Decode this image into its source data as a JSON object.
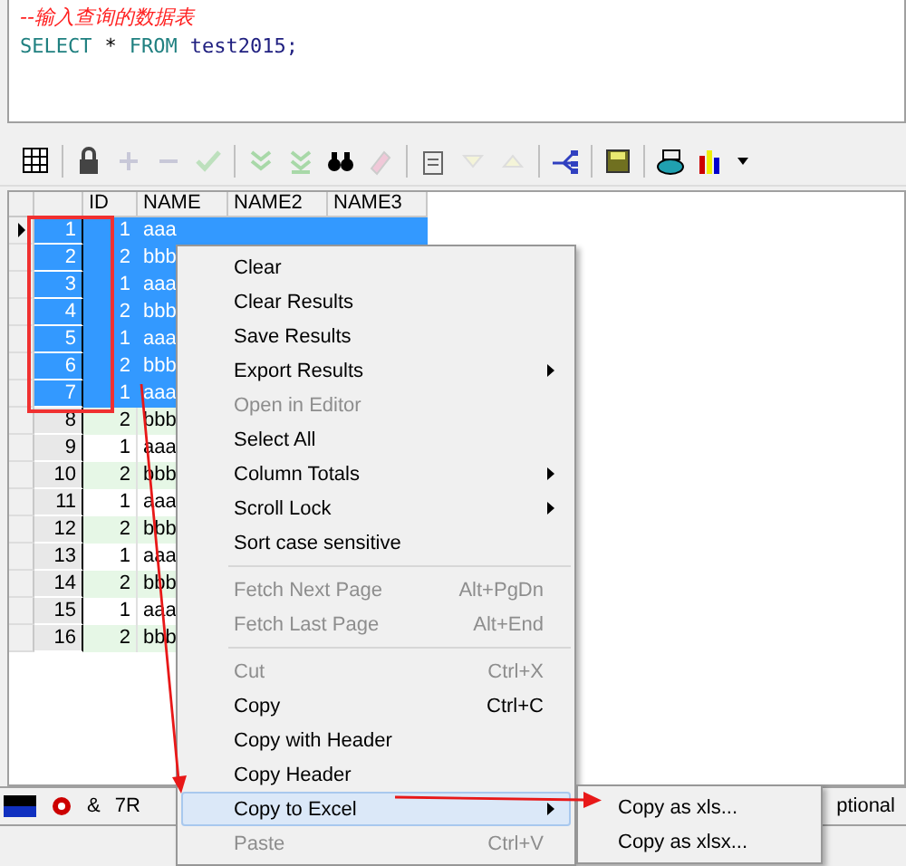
{
  "editor": {
    "comment": "--输入查询的数据表",
    "tokens": [
      {
        "text": "SELECT",
        "kind": "keyword"
      },
      {
        "text": "*",
        "kind": "operator"
      },
      {
        "text": "FROM",
        "kind": "keyword"
      },
      {
        "text": "test2015;",
        "kind": "identifier"
      }
    ]
  },
  "grid": {
    "columns": [
      "ID",
      "NAME",
      "NAME2",
      "NAME3"
    ],
    "rows": [
      {
        "num": "1",
        "id": "1",
        "name": "aaa",
        "selected": true,
        "current": true
      },
      {
        "num": "2",
        "id": "2",
        "name": "bbb",
        "selected": true,
        "current": false
      },
      {
        "num": "3",
        "id": "1",
        "name": "aaa",
        "selected": true,
        "current": false
      },
      {
        "num": "4",
        "id": "2",
        "name": "bbb",
        "selected": true,
        "current": false
      },
      {
        "num": "5",
        "id": "1",
        "name": "aaa",
        "selected": true,
        "current": false
      },
      {
        "num": "6",
        "id": "2",
        "name": "bbb",
        "selected": true,
        "current": false
      },
      {
        "num": "7",
        "id": "1",
        "name": "aaa",
        "selected": true,
        "current": false
      },
      {
        "num": "8",
        "id": "2",
        "name": "bbb",
        "selected": false,
        "current": false
      },
      {
        "num": "9",
        "id": "1",
        "name": "aaa",
        "selected": false,
        "current": false
      },
      {
        "num": "10",
        "id": "2",
        "name": "bbb",
        "selected": false,
        "current": false
      },
      {
        "num": "11",
        "id": "1",
        "name": "aaa",
        "selected": false,
        "current": false
      },
      {
        "num": "12",
        "id": "2",
        "name": "bbb",
        "selected": false,
        "current": false
      },
      {
        "num": "13",
        "id": "1",
        "name": "aaa",
        "selected": false,
        "current": false
      },
      {
        "num": "14",
        "id": "2",
        "name": "bbb",
        "selected": false,
        "current": false
      },
      {
        "num": "15",
        "id": "1",
        "name": "aaa",
        "selected": false,
        "current": false
      },
      {
        "num": "16",
        "id": "2",
        "name": "bbb",
        "selected": false,
        "current": false
      }
    ]
  },
  "context_menu": {
    "items": [
      {
        "kind": "item",
        "label": "Clear",
        "disabled": false,
        "submenu": false,
        "selected": false
      },
      {
        "kind": "item",
        "label": "Clear Results",
        "disabled": false,
        "submenu": false,
        "selected": false
      },
      {
        "kind": "item",
        "label": "Save Results",
        "disabled": false,
        "submenu": false,
        "selected": false
      },
      {
        "kind": "item",
        "label": "Export Results",
        "disabled": false,
        "submenu": true,
        "selected": false
      },
      {
        "kind": "item",
        "label": "Open in Editor",
        "disabled": true,
        "submenu": false,
        "selected": false
      },
      {
        "kind": "item",
        "label": "Select All",
        "disabled": false,
        "submenu": false,
        "selected": false
      },
      {
        "kind": "item",
        "label": "Column Totals",
        "disabled": false,
        "submenu": true,
        "selected": false
      },
      {
        "kind": "item",
        "label": "Scroll Lock",
        "disabled": false,
        "submenu": true,
        "selected": false
      },
      {
        "kind": "item",
        "label": "Sort case sensitive",
        "disabled": false,
        "submenu": false,
        "selected": false
      },
      {
        "kind": "separator"
      },
      {
        "kind": "item",
        "label": "Fetch Next Page",
        "shortcut": "Alt+PgDn",
        "disabled": true,
        "submenu": false,
        "selected": false
      },
      {
        "kind": "item",
        "label": "Fetch Last Page",
        "shortcut": "Alt+End",
        "disabled": true,
        "submenu": false,
        "selected": false
      },
      {
        "kind": "separator"
      },
      {
        "kind": "item",
        "label": "Cut",
        "shortcut": "Ctrl+X",
        "disabled": true,
        "submenu": false,
        "selected": false
      },
      {
        "kind": "item",
        "label": "Copy",
        "shortcut": "Ctrl+C",
        "disabled": false,
        "submenu": false,
        "selected": false
      },
      {
        "kind": "item",
        "label": "Copy with Header",
        "disabled": false,
        "submenu": false,
        "selected": false
      },
      {
        "kind": "item",
        "label": "Copy Header",
        "disabled": false,
        "submenu": false,
        "selected": false
      },
      {
        "kind": "item",
        "label": "Copy to Excel",
        "disabled": false,
        "submenu": true,
        "selected": true
      },
      {
        "kind": "item",
        "label": "Paste",
        "shortcut": "Ctrl+V",
        "disabled": true,
        "submenu": false,
        "selected": false
      }
    ]
  },
  "submenu": {
    "items": [
      {
        "label": "Copy as xls..."
      },
      {
        "label": "Copy as xlsx..."
      }
    ]
  },
  "status_bar": {
    "left": [
      "&",
      "7R"
    ],
    "right": "ptional"
  }
}
